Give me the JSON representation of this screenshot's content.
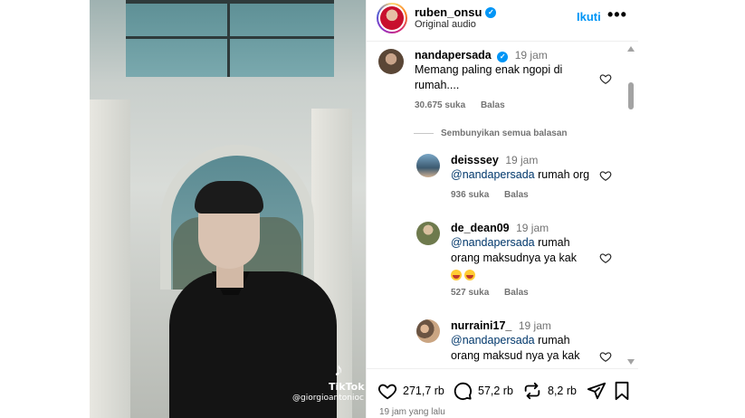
{
  "post": {
    "username": "ruben_onsu",
    "audio": "Original audio",
    "follow_label": "Ikuti",
    "more_label": "•••"
  },
  "video": {
    "watermark_logo": "♪",
    "watermark_brand": "TikTok",
    "watermark_handle": "@giorgioantonioc"
  },
  "comments": [
    {
      "username": "nandapersada",
      "verified": true,
      "time": "19 jam",
      "text": "Memang paling enak ngopi di rumah....",
      "likes": "30.675 suka",
      "reply_label": "Balas"
    }
  ],
  "hide_replies_label": "Sembunyikan semua balasan",
  "replies": [
    {
      "username": "deisssey",
      "time": "19 jam",
      "mention": "@nandapersada",
      "text": " rumah org",
      "likes": "936 suka",
      "reply_label": "Balas"
    },
    {
      "username": "de_dean09",
      "time": "19 jam",
      "mention": "@nandapersada",
      "text": " rumah orang maksudnya ya kak",
      "likes": "527 suka",
      "reply_label": "Balas"
    },
    {
      "username": "nurraini17_",
      "time": "19 jam",
      "mention": "@nandapersada",
      "text": " rumah orang maksud nya ya kak"
    }
  ],
  "actions": {
    "likes": "271,7 rb",
    "comments": "57,2 rb",
    "reposts": "8,2 rb"
  },
  "posted_ago": "19 jam yang lalu",
  "colors": {
    "accent": "#0095f6",
    "mention": "#00376b",
    "muted": "#737373"
  }
}
